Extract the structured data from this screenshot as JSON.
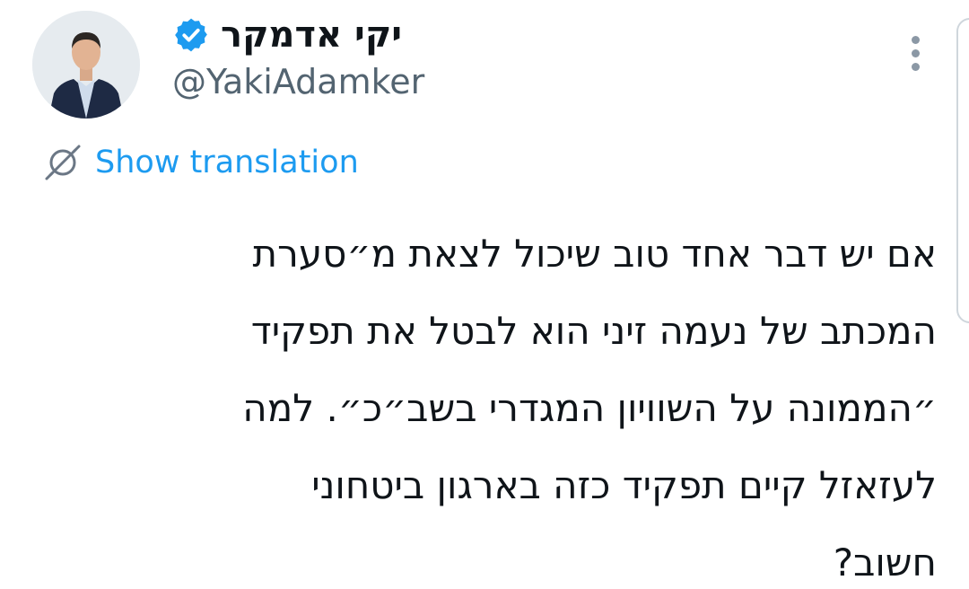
{
  "author": {
    "display_name": "יקי אדמקר",
    "handle": "@YakiAdamker",
    "verified_color": "#1d9bf0"
  },
  "icons": {
    "verified": "verified-badge-icon",
    "more": "more-vertical-icon",
    "translate": "globe-translate-icon"
  },
  "translation": {
    "label": "Show translation"
  },
  "tweet": {
    "lines": [
      "אם יש דבר אחד טוב שיכול לצאת מ״סערת",
      "המכתב של נעמה זיני הוא לבטל את תפקיד",
      "״הממונה על השוויון המגדרי בשב״כ״. למה",
      "לעזאזל קיים תפקיד כזה בארגון ביטחוני",
      "חשוב?"
    ]
  },
  "colors": {
    "text": "#0f1419",
    "secondary": "#536471",
    "link": "#1d9bf0"
  }
}
